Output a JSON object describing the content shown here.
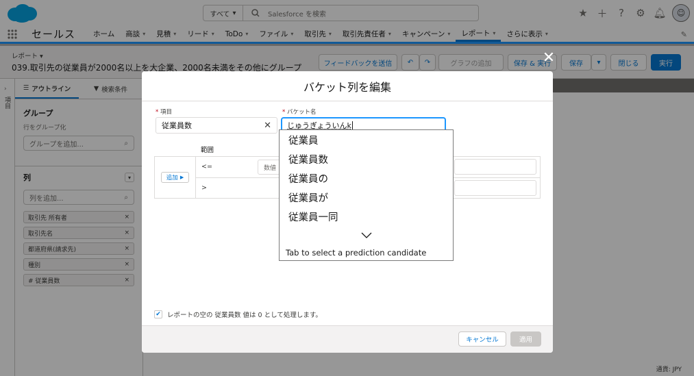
{
  "global_search": {
    "scope": "すべて",
    "placeholder": "Salesforce を検索"
  },
  "nav": {
    "app_name": "セールス",
    "items": [
      "ホーム",
      "商談",
      "見積",
      "リード",
      "ToDo",
      "ファイル",
      "取引先",
      "取引先責任者",
      "キャンペーン",
      "レポート",
      "さらに表示"
    ],
    "active": "レポート"
  },
  "report_header": {
    "label": "レポート",
    "title": "039.取引先の従業員が2000名以上を大企業、2000名未満をその他にグループ",
    "buttons": {
      "feedback": "フィードバックを送信",
      "add_chart": "グラフの追加",
      "save_run": "保存 & 実行",
      "save": "保存",
      "close": "閉じる",
      "run": "実行"
    }
  },
  "left_panel": {
    "rail_label": "項目",
    "tabs": [
      "アウトライン",
      "検索条件"
    ],
    "groups_title": "グループ",
    "groups_sub": "行をグループ化",
    "groups_placeholder": "グループを追加...",
    "columns_title": "列",
    "columns_placeholder": "列を追加...",
    "columns": [
      "取引先 所有者",
      "取引先名",
      "都道府県(請求先)",
      "種別",
      "# 従業員数"
    ]
  },
  "modal": {
    "title": "バケット列を編集",
    "item_label": "項目",
    "item_value": "従業員数",
    "bucket_label": "バケット名",
    "bucket_value": "じゅうぎょういんk",
    "range_header": "範囲",
    "add_button": "追加",
    "rows": [
      {
        "op": "<=",
        "placeholder": "数値"
      },
      {
        "op": ">"
      }
    ],
    "ime_candidates": [
      "従業員",
      "従業員数",
      "従業員の",
      "従業員が",
      "従業員一同"
    ],
    "ime_hint": "Tab to select a prediction candidate",
    "empty_values_text": "レポートの空の 従業員数 値は 0 として処理します。",
    "cancel": "キャンセル",
    "apply": "適用"
  },
  "footer": {
    "currency": "通貨: JPY"
  }
}
